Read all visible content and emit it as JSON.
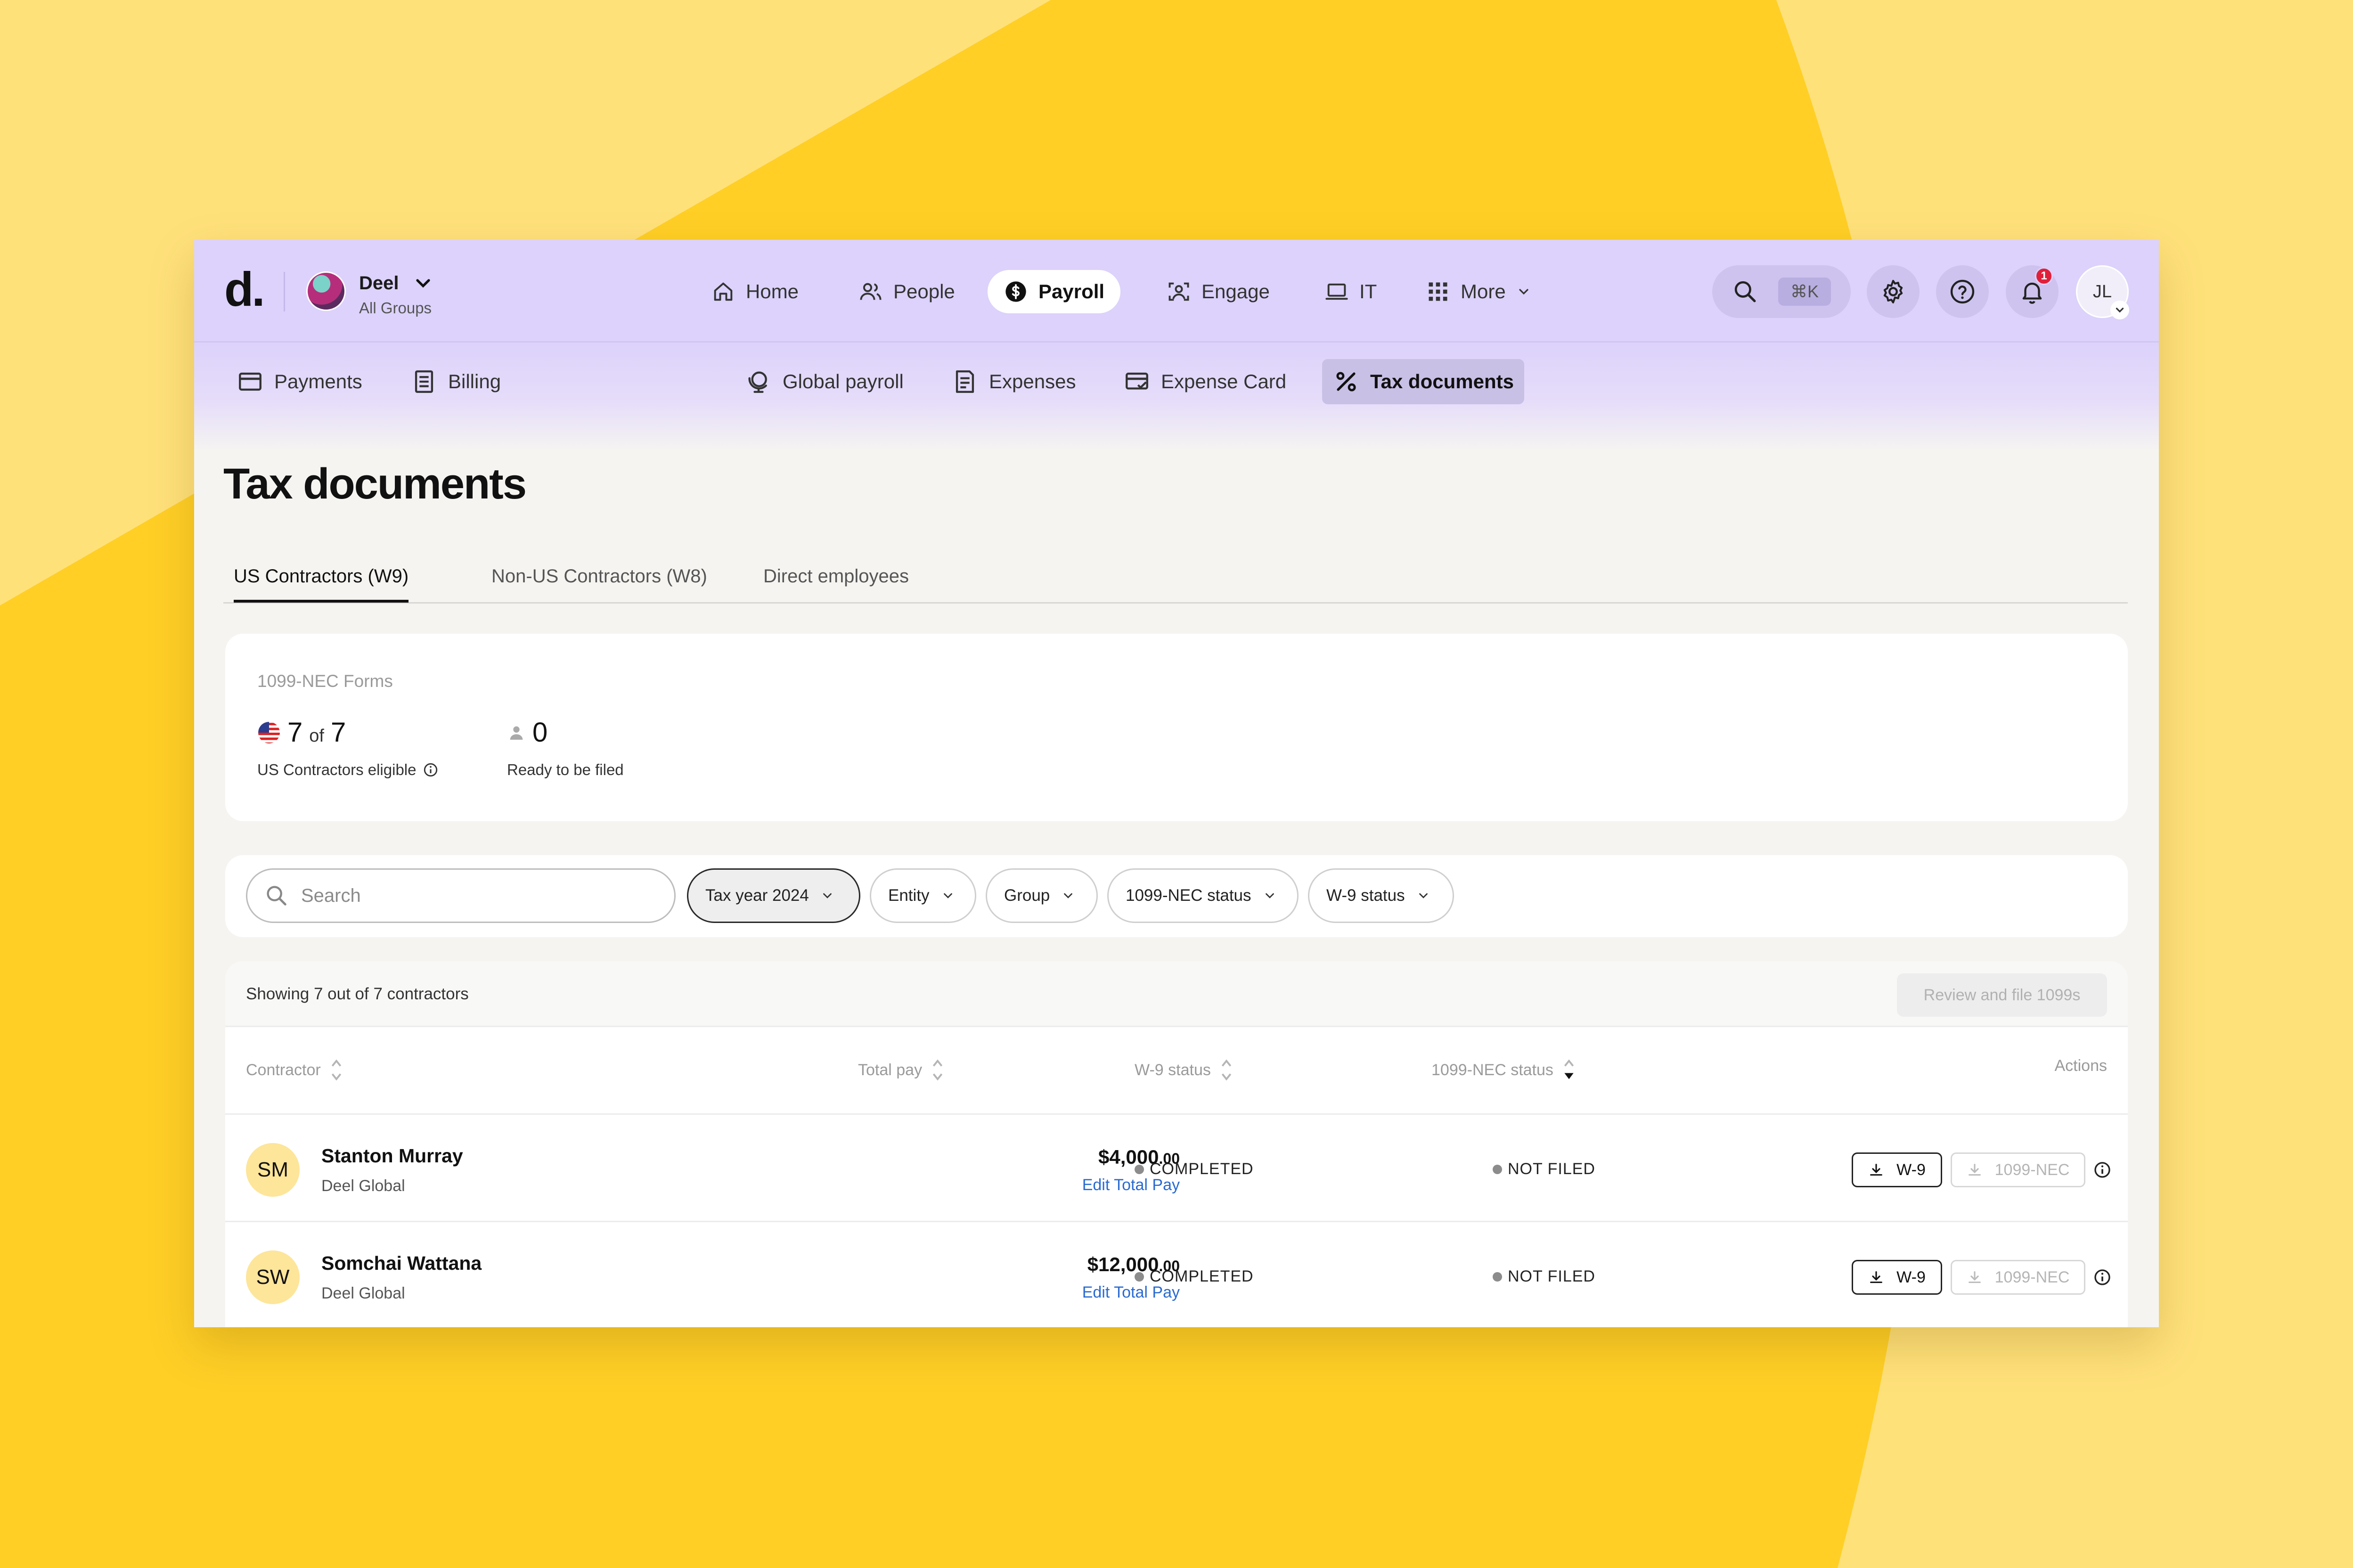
{
  "brand": {
    "logo": "d."
  },
  "org": {
    "name": "Deel",
    "subtitle": "All Groups"
  },
  "nav": [
    {
      "label": "Home",
      "icon": "home-icon"
    },
    {
      "label": "People",
      "icon": "people-icon"
    },
    {
      "label": "Payroll",
      "icon": "dollar-icon",
      "active": true
    },
    {
      "label": "Engage",
      "icon": "engage-icon"
    },
    {
      "label": "IT",
      "icon": "laptop-icon"
    },
    {
      "label": "More",
      "icon": "grid-icon"
    }
  ],
  "search_shortcut": "⌘K",
  "notifications": {
    "count": "1"
  },
  "user": {
    "initials": "JL"
  },
  "subnav": [
    {
      "label": "Payments",
      "icon": "card-icon"
    },
    {
      "label": "Billing",
      "icon": "billing-icon"
    },
    {
      "label": "Global payroll",
      "icon": "global-payroll-icon"
    },
    {
      "label": "Expenses",
      "icon": "receipt-icon"
    },
    {
      "label": "Expense Card",
      "icon": "expense-card-icon"
    },
    {
      "label": "Tax documents",
      "icon": "percent-icon",
      "active": true
    }
  ],
  "page": {
    "title": "Tax documents"
  },
  "tabs": [
    {
      "label": "US Contractors (W9)",
      "active": true
    },
    {
      "label": "Non-US Contractors (W8)"
    },
    {
      "label": "Direct employees"
    }
  ],
  "summary": {
    "title": "1099-NEC Forms",
    "eligible": {
      "value": "7",
      "of": "of",
      "total": "7",
      "label": "US Contractors eligible"
    },
    "ready": {
      "value": "0",
      "label": "Ready to be filed"
    }
  },
  "filters": {
    "search_placeholder": "Search",
    "items": [
      {
        "label": "Tax year 2024",
        "active": true
      },
      {
        "label": "Entity"
      },
      {
        "label": "Group"
      },
      {
        "label": "1099-NEC status"
      },
      {
        "label": "W-9 status"
      }
    ]
  },
  "table": {
    "showing": "Showing 7 out of 7 contractors",
    "review_button": "Review and file 1099s",
    "columns": [
      "Contractor",
      "Total pay",
      "W-9 status",
      "1099-NEC status",
      "Actions"
    ],
    "rows": [
      {
        "initials": "SM",
        "name": "Stanton Murray",
        "entity": "Deel Global",
        "pay_main": "$4,000",
        "pay_cents": ".00",
        "edit": "Edit Total Pay",
        "w9_status": "COMPLETED",
        "nec_status": "NOT FILED",
        "w9_btn": "W-9",
        "nec_btn": "1099-NEC"
      },
      {
        "initials": "SW",
        "name": "Somchai Wattana",
        "entity": "Deel Global",
        "pay_main": "$12,000",
        "pay_cents": ".00",
        "edit": "Edit Total Pay",
        "w9_status": "COMPLETED",
        "nec_status": "NOT FILED",
        "w9_btn": "W-9",
        "nec_btn": "1099-NEC"
      }
    ]
  },
  "colors": {
    "accent_bar": "#dcd2fb",
    "background": "#ffcf26",
    "avatar": "#fde59a",
    "link": "#2a6ad0",
    "badge": "#e0203a"
  }
}
